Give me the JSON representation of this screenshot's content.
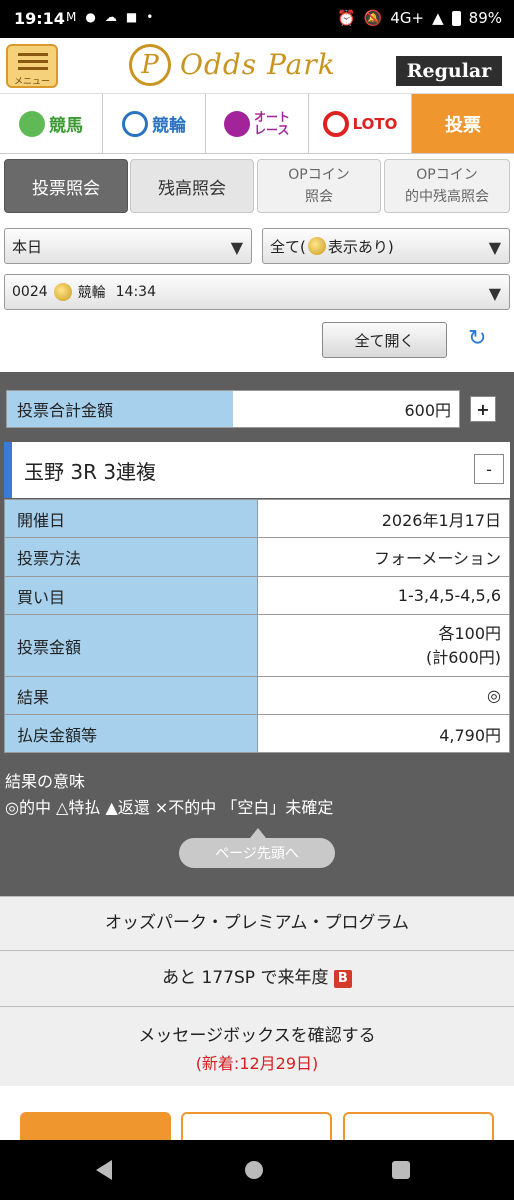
{
  "status_bar": {
    "time": "19:14",
    "network": "4G+",
    "battery": "89%",
    "icons": [
      "gmail-icon",
      "app-icon",
      "cloud-icon",
      "app-badge-icon",
      "dot-icon",
      "alarm-icon",
      "mute-icon",
      "signal-icon",
      "battery-icon"
    ]
  },
  "header": {
    "menu_label": "メニュー",
    "logo_letter": "P",
    "logo_text": "Odds Park",
    "account_badge": "Regular"
  },
  "category_tabs": [
    {
      "label": "競馬",
      "icon": "horse-icon",
      "active": false
    },
    {
      "label": "競輪",
      "icon": "bicycle-icon",
      "active": false
    },
    {
      "label": "オート\nレース",
      "icon": "motorbike-icon",
      "active": false
    },
    {
      "label": "LOTO",
      "icon": "target-icon",
      "active": false
    },
    {
      "label": "投票",
      "icon": "",
      "active": true
    }
  ],
  "sub_tabs": [
    {
      "label": "投票照会",
      "active": true
    },
    {
      "label": "残高照会",
      "active": false
    },
    {
      "label": "OPコイン\n照会",
      "active": false
    },
    {
      "label": "OPコイン\n的中残高照会",
      "active": false
    }
  ],
  "filters": {
    "period": "本日",
    "display_prefix": "全て(",
    "display_suffix": "表示あり)",
    "ticket_id": "0024",
    "ticket_sport": "競輪",
    "ticket_time": "14:34"
  },
  "actions": {
    "open_all": "全て開く"
  },
  "summary": {
    "total_label": "投票合計金額",
    "total_value": "600円",
    "expand": "+"
  },
  "race": {
    "title": "玉野 3R 3連複",
    "collapse": "-",
    "rows": [
      {
        "key": "開催日",
        "value": "2026年1月17日"
      },
      {
        "key": "投票方法",
        "value": "フォーメーション"
      },
      {
        "key": "買い目",
        "value": "1-3,4,5-4,5,6"
      },
      {
        "key": "投票金額",
        "value": "各100円\n(計600円)"
      },
      {
        "key": "結果",
        "value": "◎"
      },
      {
        "key": "払戻金額等",
        "value": "4,790円"
      }
    ]
  },
  "legend": {
    "title": "結果の意味",
    "body": "◎的中 △特払 ▲返還 ×不的中 「空白」未確定"
  },
  "to_top": "ページ先頭へ",
  "panels": {
    "premium": "オッズパーク・プレミアム・プログラム",
    "sp_prefix": "あと 177SP で来年度",
    "sp_badge": "B",
    "message_box": "メッセージボックスを確認する",
    "message_new": "(新着:12月29日)"
  },
  "colors": {
    "accent_orange": "#f0962e",
    "label_blue": "#a7d0ec",
    "race_bar_blue": "#3b7bd6",
    "gold": "#c9941f",
    "new_red": "#d61f1f"
  }
}
